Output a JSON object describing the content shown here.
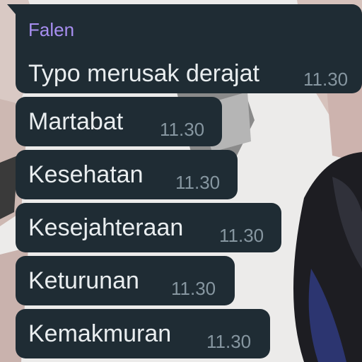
{
  "colors": {
    "bubble_background": "#1f2c34",
    "sender_name": "#a78ef0",
    "message_text": "#e9edef",
    "timestamp": "#8696a0"
  },
  "group": {
    "sender": "Falen"
  },
  "messages": [
    {
      "text": "Typo merusak derajat",
      "time": "11.30"
    },
    {
      "text": "Martabat",
      "time": "11.30"
    },
    {
      "text": "Kesehatan",
      "time": "11.30"
    },
    {
      "text": "Kesejahteraan",
      "time": "11.30"
    },
    {
      "text": "Keturunan",
      "time": "11.30"
    },
    {
      "text": "Kemakmuran",
      "time": "11.30"
    }
  ]
}
